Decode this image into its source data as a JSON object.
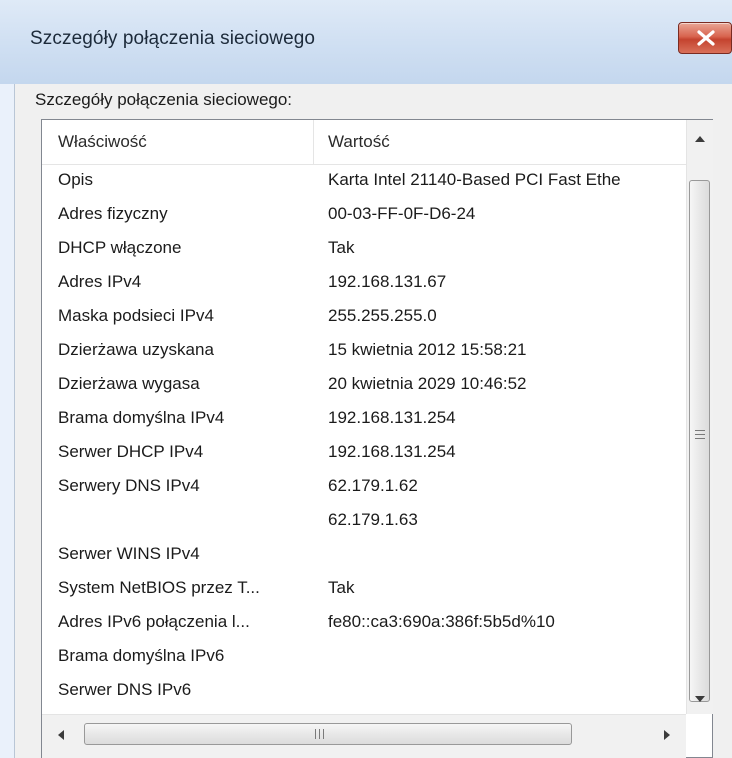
{
  "window": {
    "title": "Szczegóły połączenia sieciowego",
    "close_icon": "close-icon",
    "accent_close": "#c4432f"
  },
  "details": {
    "group_label": "Szczegóły połączenia sieciowego:",
    "columns": [
      "Właściwość",
      "Wartość"
    ],
    "rows": [
      {
        "property": "Opis",
        "value": "Karta Intel 21140-Based PCI Fast Ethe"
      },
      {
        "property": "Adres fizyczny",
        "value": "00-03-FF-0F-D6-24"
      },
      {
        "property": "DHCP włączone",
        "value": "Tak"
      },
      {
        "property": "Adres IPv4",
        "value": "192.168.131.67"
      },
      {
        "property": "Maska podsieci IPv4",
        "value": "255.255.255.0"
      },
      {
        "property": "Dzierżawa uzyskana",
        "value": "15 kwietnia 2012 15:58:21"
      },
      {
        "property": "Dzierżawa wygasa",
        "value": "20 kwietnia 2029 10:46:52"
      },
      {
        "property": "Brama domyślna IPv4",
        "value": "192.168.131.254"
      },
      {
        "property": "Serwer DHCP IPv4",
        "value": "192.168.131.254"
      },
      {
        "property": "Serwery DNS IPv4",
        "value": "62.179.1.62"
      },
      {
        "property": "",
        "value": "62.179.1.63"
      },
      {
        "property": "Serwer WINS IPv4",
        "value": ""
      },
      {
        "property": "System NetBIOS przez T...",
        "value": "Tak"
      },
      {
        "property": "Adres IPv6 połączenia l...",
        "value": "fe80::ca3:690a:386f:5b5d%10"
      },
      {
        "property": "Brama domyślna IPv6",
        "value": ""
      },
      {
        "property": "Serwer DNS IPv6",
        "value": ""
      }
    ]
  },
  "scrollbars": {
    "vertical_up_icon": "chevron-up-icon",
    "vertical_down_icon": "chevron-down-icon",
    "horizontal_left_icon": "chevron-left-icon",
    "horizontal_right_icon": "chevron-right-icon"
  }
}
